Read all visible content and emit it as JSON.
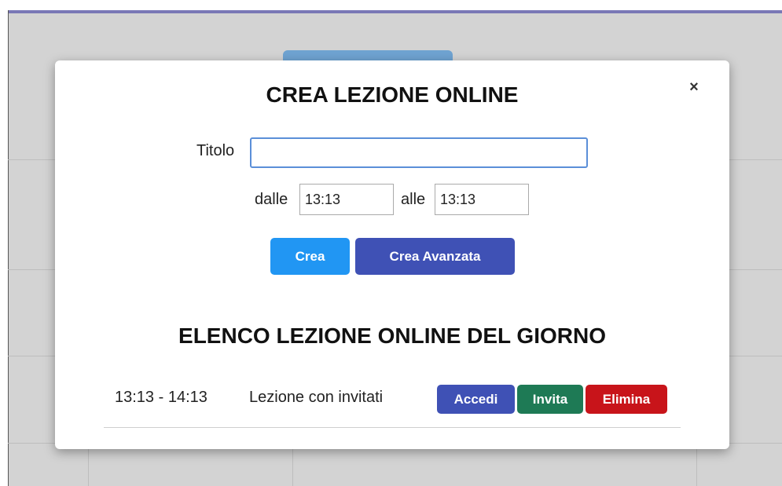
{
  "modal": {
    "title": "CREA LEZIONE ONLINE",
    "close_label": "×",
    "form": {
      "title_label": "Titolo",
      "title_value": "",
      "from_label": "dalle",
      "from_value": "13:13",
      "to_label": "alle",
      "to_value": "13:13"
    },
    "buttons": {
      "create": "Crea",
      "create_advanced": "Crea Avanzata"
    },
    "list_title": "ELENCO LEZIONE ONLINE DEL GIORNO",
    "lessons": [
      {
        "time": "13:13 - 14:13",
        "title": "Lezione con invitati",
        "join_label": "Accedi",
        "invite_label": "Invita",
        "delete_label": "Elimina"
      }
    ]
  },
  "colors": {
    "primary": "#2196f3",
    "indigo": "#3f51b5",
    "success": "#1e7a55",
    "danger": "#c8141a",
    "overlay": "#d3d3d3"
  }
}
